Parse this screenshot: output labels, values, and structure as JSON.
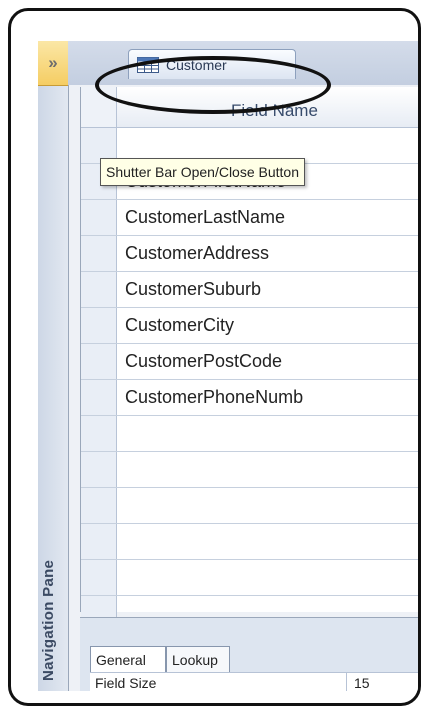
{
  "shutter_button": {
    "glyph": "»"
  },
  "navigation_pane": {
    "label": "Navigation Pane"
  },
  "tabs": [
    {
      "label": "Customer",
      "icon": "table-icon"
    }
  ],
  "design_grid": {
    "column_header": "Field Name",
    "fields": [
      "",
      "CustomerFirstName",
      "CustomerLastName",
      "CustomerAddress",
      "CustomerSuburb",
      "CustomerCity",
      "CustomerPostCode",
      "CustomerPhoneNumb",
      "",
      "",
      "",
      "",
      "",
      ""
    ]
  },
  "tooltip": {
    "text": "Shutter Bar Open/Close Button"
  },
  "field_properties": {
    "tabs": [
      "General",
      "Lookup"
    ],
    "active_tab": "General",
    "rows": [
      {
        "name": "Field Size",
        "value": "15"
      }
    ]
  },
  "colors": {
    "shutter_button": "#f5cd63",
    "nav_pane": "#cdd7e6",
    "annotation_outline": "#111111"
  }
}
